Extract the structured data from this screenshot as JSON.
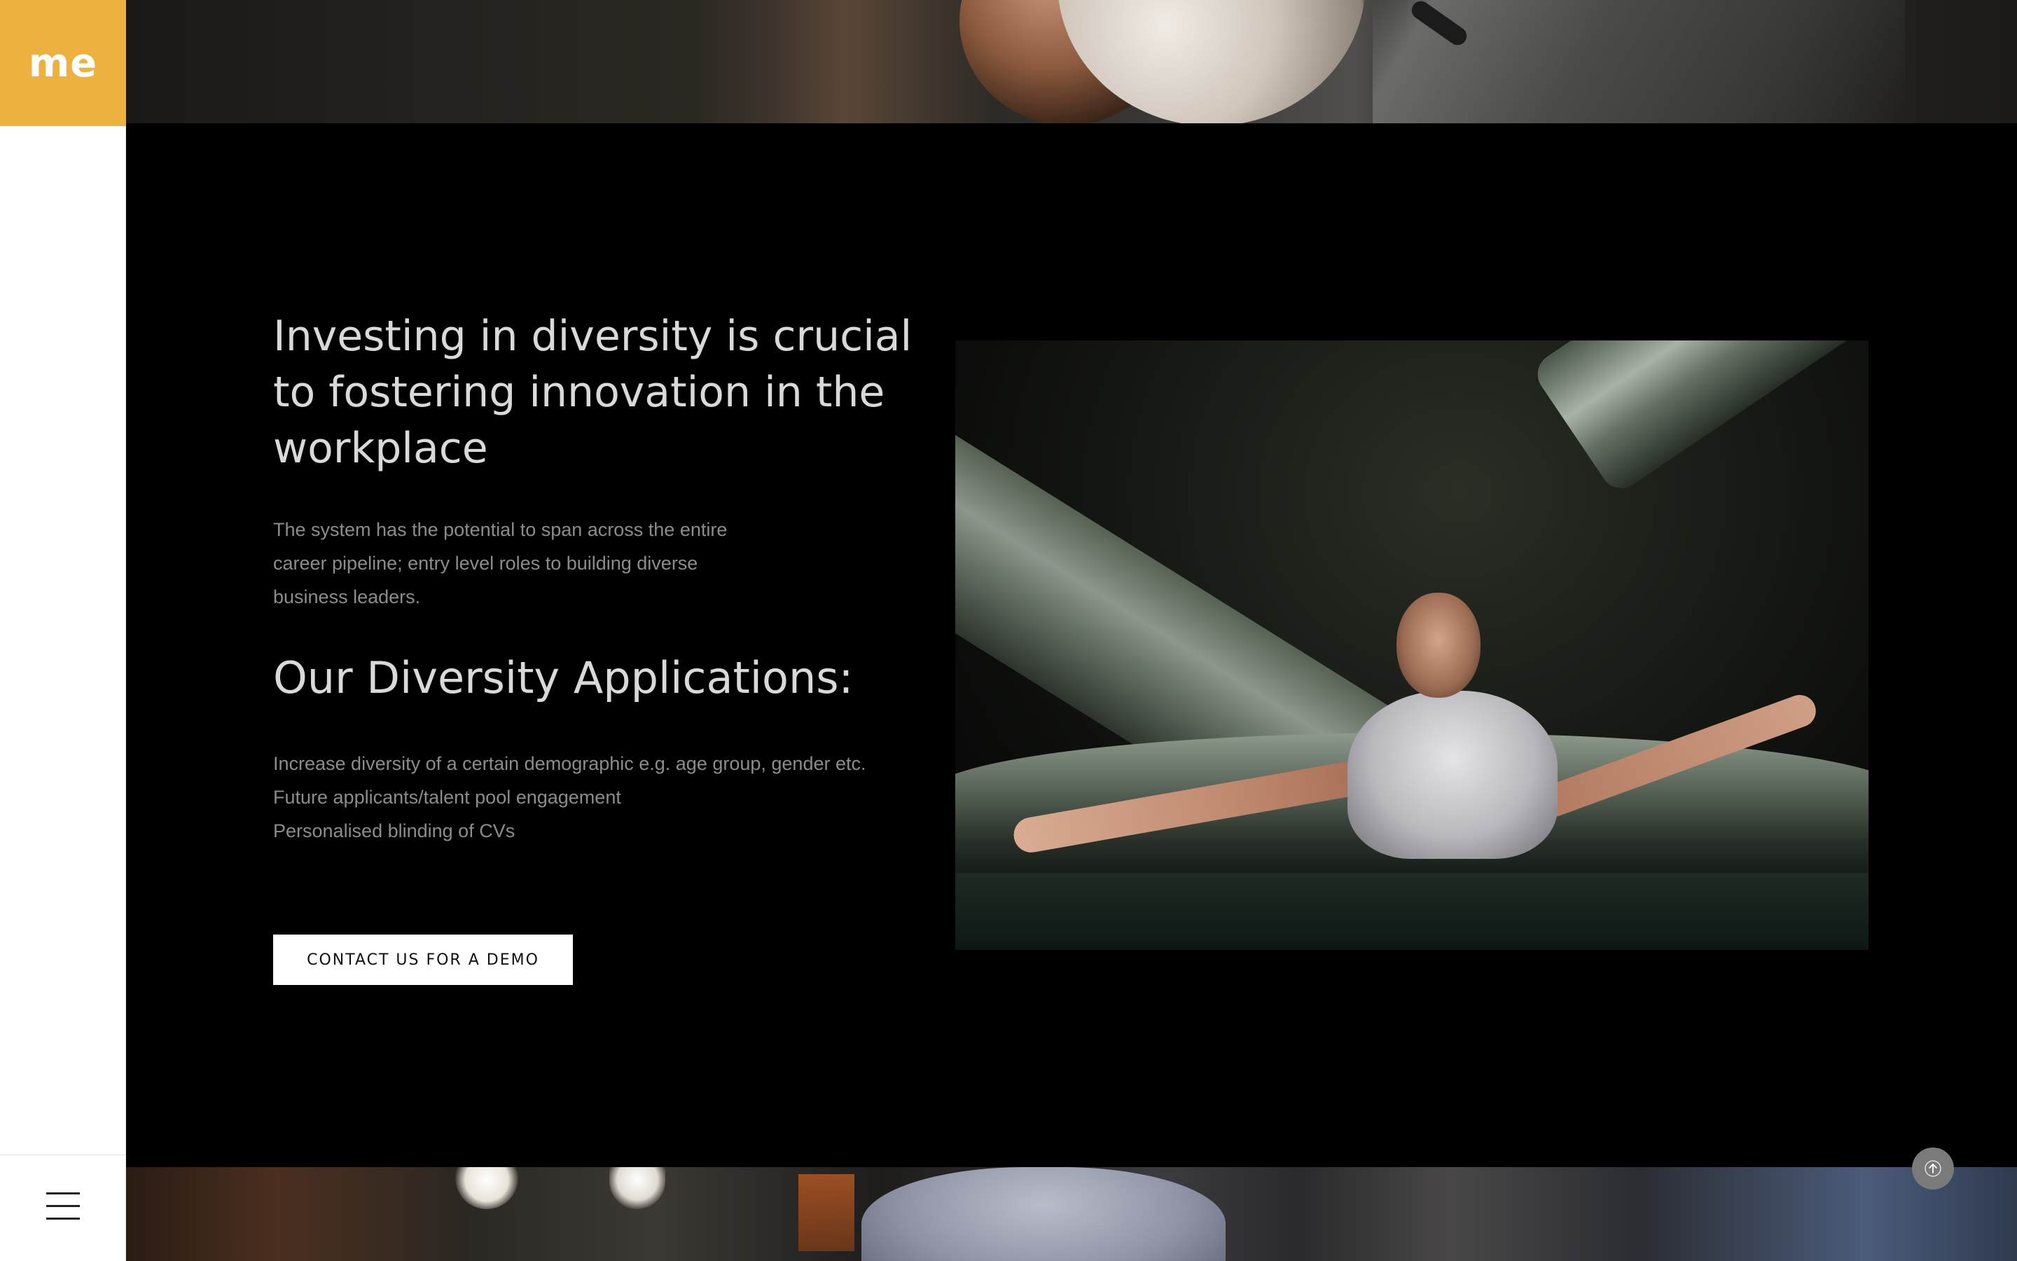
{
  "brand": {
    "logo_text": "me",
    "accent_color": "#edb13f"
  },
  "sidebar": {
    "menu_icon": "hamburger-menu-icon"
  },
  "section": {
    "heading": "Investing in diversity is crucial to fostering innovation in the workplace",
    "intro": "The system has the potential to span across the entire career pipeline; entry level roles to building diverse business leaders.",
    "subheading": "Our Diversity Applications:",
    "applications": [
      "Increase diversity of a certain demographic e.g. age group, gender etc.",
      "Future applicants/talent pool engagement",
      "Personalised blinding of CVs"
    ],
    "cta_label": "CONTACT US FOR A DEMO"
  },
  "scroll_top": {
    "icon": "arrow-up-icon"
  }
}
